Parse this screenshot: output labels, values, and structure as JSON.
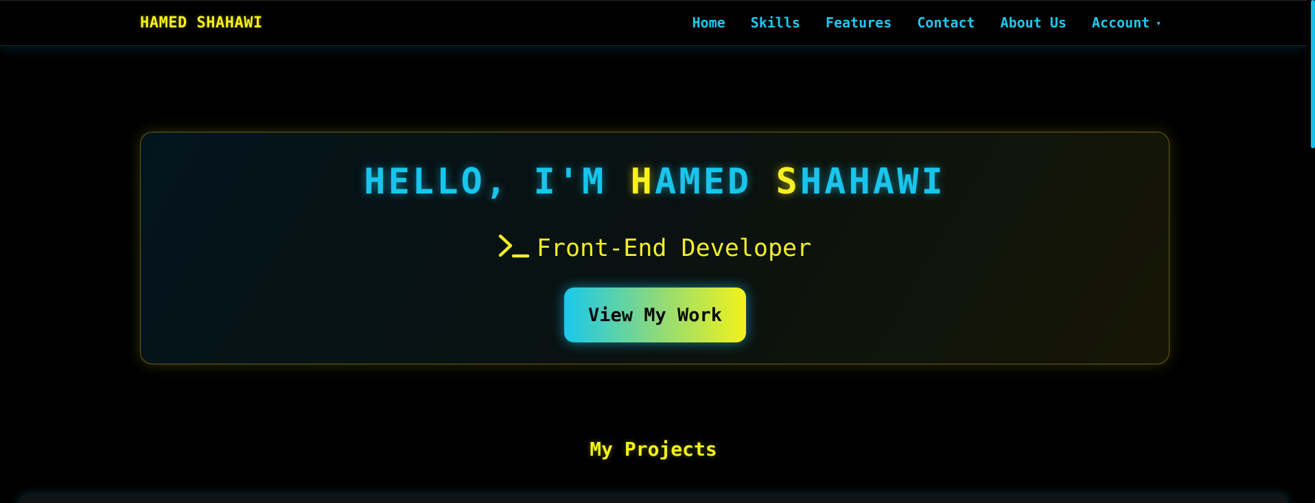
{
  "navbar": {
    "brand": "HAMED SHAHAWI",
    "links": [
      "Home",
      "Skills",
      "Features",
      "Contact",
      "About Us"
    ],
    "account_label": "Account",
    "account_caret": "▾"
  },
  "hero": {
    "title_parts": [
      "HELLO, I'M ",
      "H",
      "AMED ",
      "S",
      "HAHAWI"
    ],
    "subtitle": "Front-End Developer",
    "cta_label": "View My Work"
  },
  "projects": {
    "title": "My Projects"
  },
  "icons": {
    "subtitle_icon": "terminal-icon",
    "account_icon": "chevron-down-icon"
  },
  "colors": {
    "accent_cyan": "#18c5ec",
    "accent_yellow": "#f2f21a",
    "background": "#000000"
  }
}
